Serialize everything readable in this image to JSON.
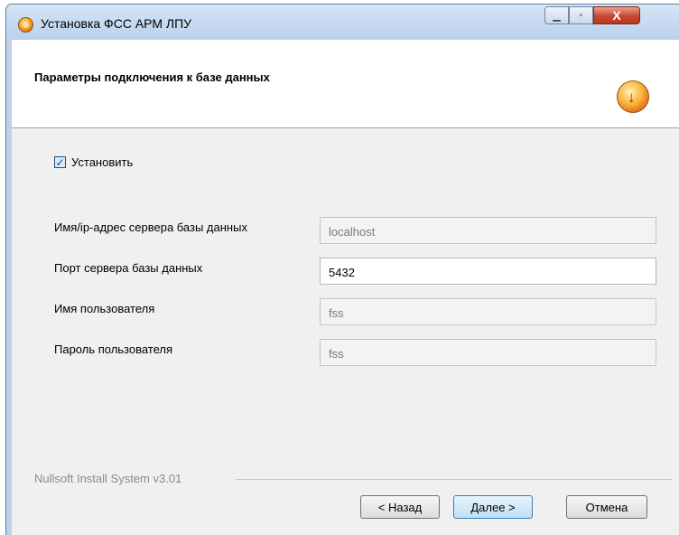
{
  "window": {
    "title": "Установка ФСС АРМ ЛПУ",
    "minimize_label": "▁",
    "maximize_label": "▫",
    "close_label": "X"
  },
  "header": {
    "title": "Параметры подключения к базе данных"
  },
  "install_checkbox": {
    "label": "Установить",
    "checked": true,
    "mark": "✓"
  },
  "form": {
    "server_label": "Имя/ip-адрес сервера базы данных",
    "server_value": "localhost",
    "port_label": "Порт сервера базы данных",
    "port_value": "5432",
    "user_label": "Имя пользователя",
    "user_value": "fss",
    "password_label": "Пароль пользователя",
    "password_value": "fss"
  },
  "footer": {
    "brand": "Nullsoft Install System v3.01",
    "back_label": "< Назад",
    "next_label": "Далее >",
    "cancel_label": "Отмена"
  },
  "colors": {
    "title_bar": "#bcd1ea",
    "close_button": "#c9452f",
    "default_button": "#bfe0f7"
  },
  "icons": {
    "app": "installer-icon",
    "header_logo": "install-logo-icon"
  }
}
